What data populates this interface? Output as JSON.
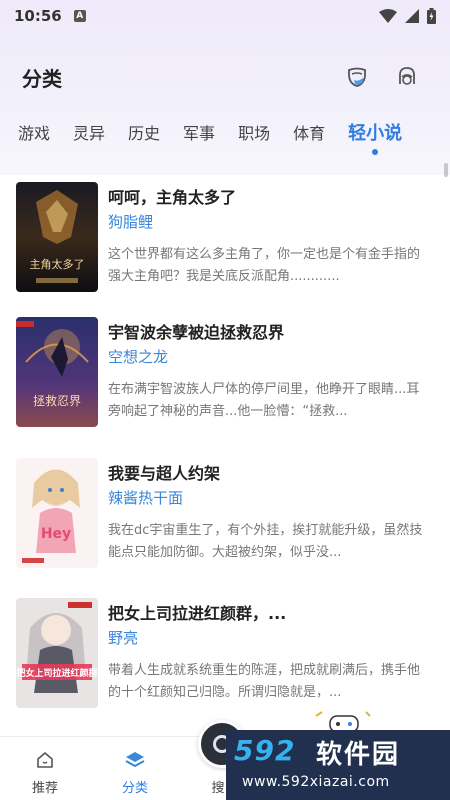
{
  "status_bar": {
    "time": "10:56",
    "indicator": "A"
  },
  "header": {
    "title": "分类"
  },
  "tabs": [
    {
      "label": "游戏"
    },
    {
      "label": "灵异"
    },
    {
      "label": "历史"
    },
    {
      "label": "军事"
    },
    {
      "label": "职场"
    },
    {
      "label": "体育"
    },
    {
      "label": "轻小说",
      "active": true
    }
  ],
  "books": [
    {
      "title": "呵呵，主角太多了",
      "author": "狗脂鲤",
      "description": "这个世界都有这么多主角了，你一定也是个有金手指的强大主角吧？我是关底反派配角............",
      "cover_text": "主角太多了"
    },
    {
      "title": "宇智波余孽被迫拯救忍界",
      "author": "空想之龙",
      "description": "在布满宇智波族人尸体的停尸间里，他睁开了眼睛...耳旁响起了神秘的声音...他一脸懵：“拯救...",
      "cover_text": "拯救忍界"
    },
    {
      "title": "我要与超人约架",
      "author": "辣酱热干面",
      "description": "我在dc宇宙重生了，有个外挂，挨打就能升级，虽然技能点只能加防御。大超被约架，似乎没...",
      "cover_text": "Hey"
    },
    {
      "title": "把女上司拉进红颜群，...",
      "author": "野亮",
      "description": "带着人生成就系统重生的陈涯，把成就刷满后，携手他的十个红颜知己归隐。所谓归隐就是，...",
      "cover_text": "把女上司拉进红颜群"
    }
  ],
  "bottom_nav": [
    {
      "label": "推荐",
      "icon": "home-icon"
    },
    {
      "label": "分类",
      "icon": "layers-icon",
      "active": true
    },
    {
      "label": "搜",
      "icon": "search-icon"
    }
  ],
  "watermark": {
    "brand_num": "592",
    "brand_cn": "软件园",
    "url": "www.592xiazai.com"
  },
  "colors": {
    "accent": "#2f7de1",
    "author": "#3a86d8"
  }
}
